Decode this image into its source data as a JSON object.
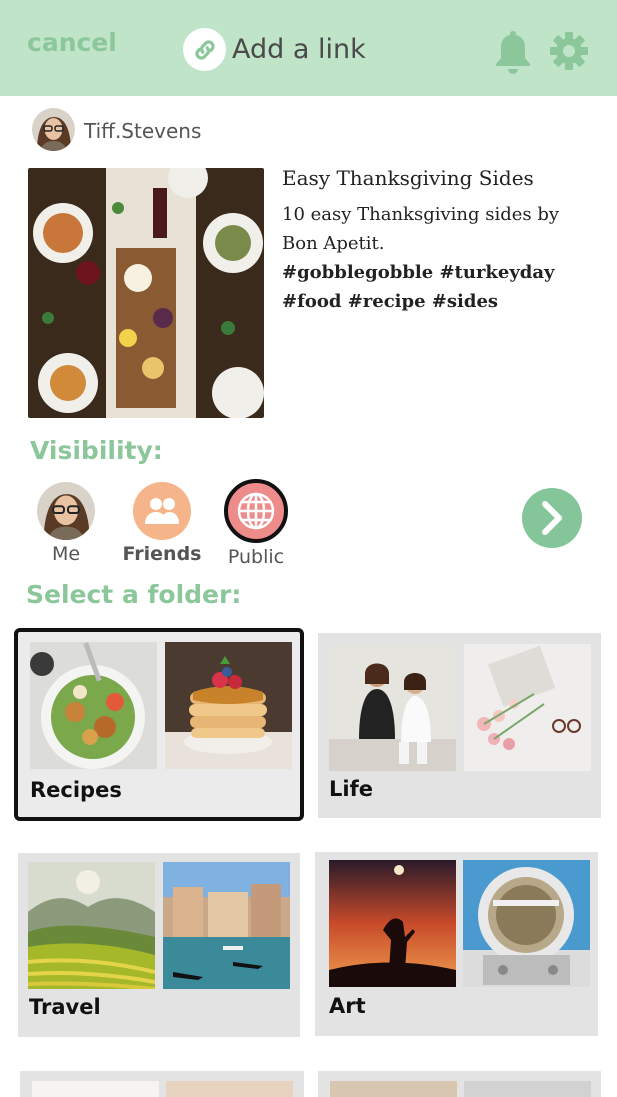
{
  "header": {
    "cancel_label": "cancel",
    "title": "Add a link",
    "link_icon": "link-icon",
    "bell_icon": "bell-icon",
    "settings_icon": "gear-icon",
    "background": "#bfe4c8",
    "accent": "#8cc79c"
  },
  "user": {
    "name": "Tiff.Stevens",
    "avatar": "profile-photo"
  },
  "post": {
    "title": "Easy Thanksgiving Sides",
    "description": "10 easy Thanksgiving sides by Bon Apetit.",
    "hashtags": "#gobblegobble #turkeyday #food #recipe #sides",
    "image": "thanksgiving-table-photo"
  },
  "visibility": {
    "label": "Visibility:",
    "options": [
      {
        "label": "Me",
        "icon": "profile-photo"
      },
      {
        "label": "Friends",
        "icon": "group-icon"
      },
      {
        "label": "Public",
        "icon": "globe-icon"
      }
    ],
    "next_icon": "chevron-right-icon"
  },
  "folders": {
    "label": "Select a folder:",
    "items": [
      {
        "name": "Recipes",
        "images": [
          "salad-photo",
          "pancakes-photo"
        ],
        "selected": true
      },
      {
        "name": "Life",
        "images": [
          "friends-photo",
          "flowers-photo"
        ],
        "selected": false
      },
      {
        "name": "Travel",
        "images": [
          "rice-terraces-photo",
          "venice-canal-photo"
        ],
        "selected": false
      },
      {
        "name": "Art",
        "images": [
          "sunset-silhouette-photo",
          "astronaut-photo"
        ],
        "selected": false
      }
    ]
  }
}
